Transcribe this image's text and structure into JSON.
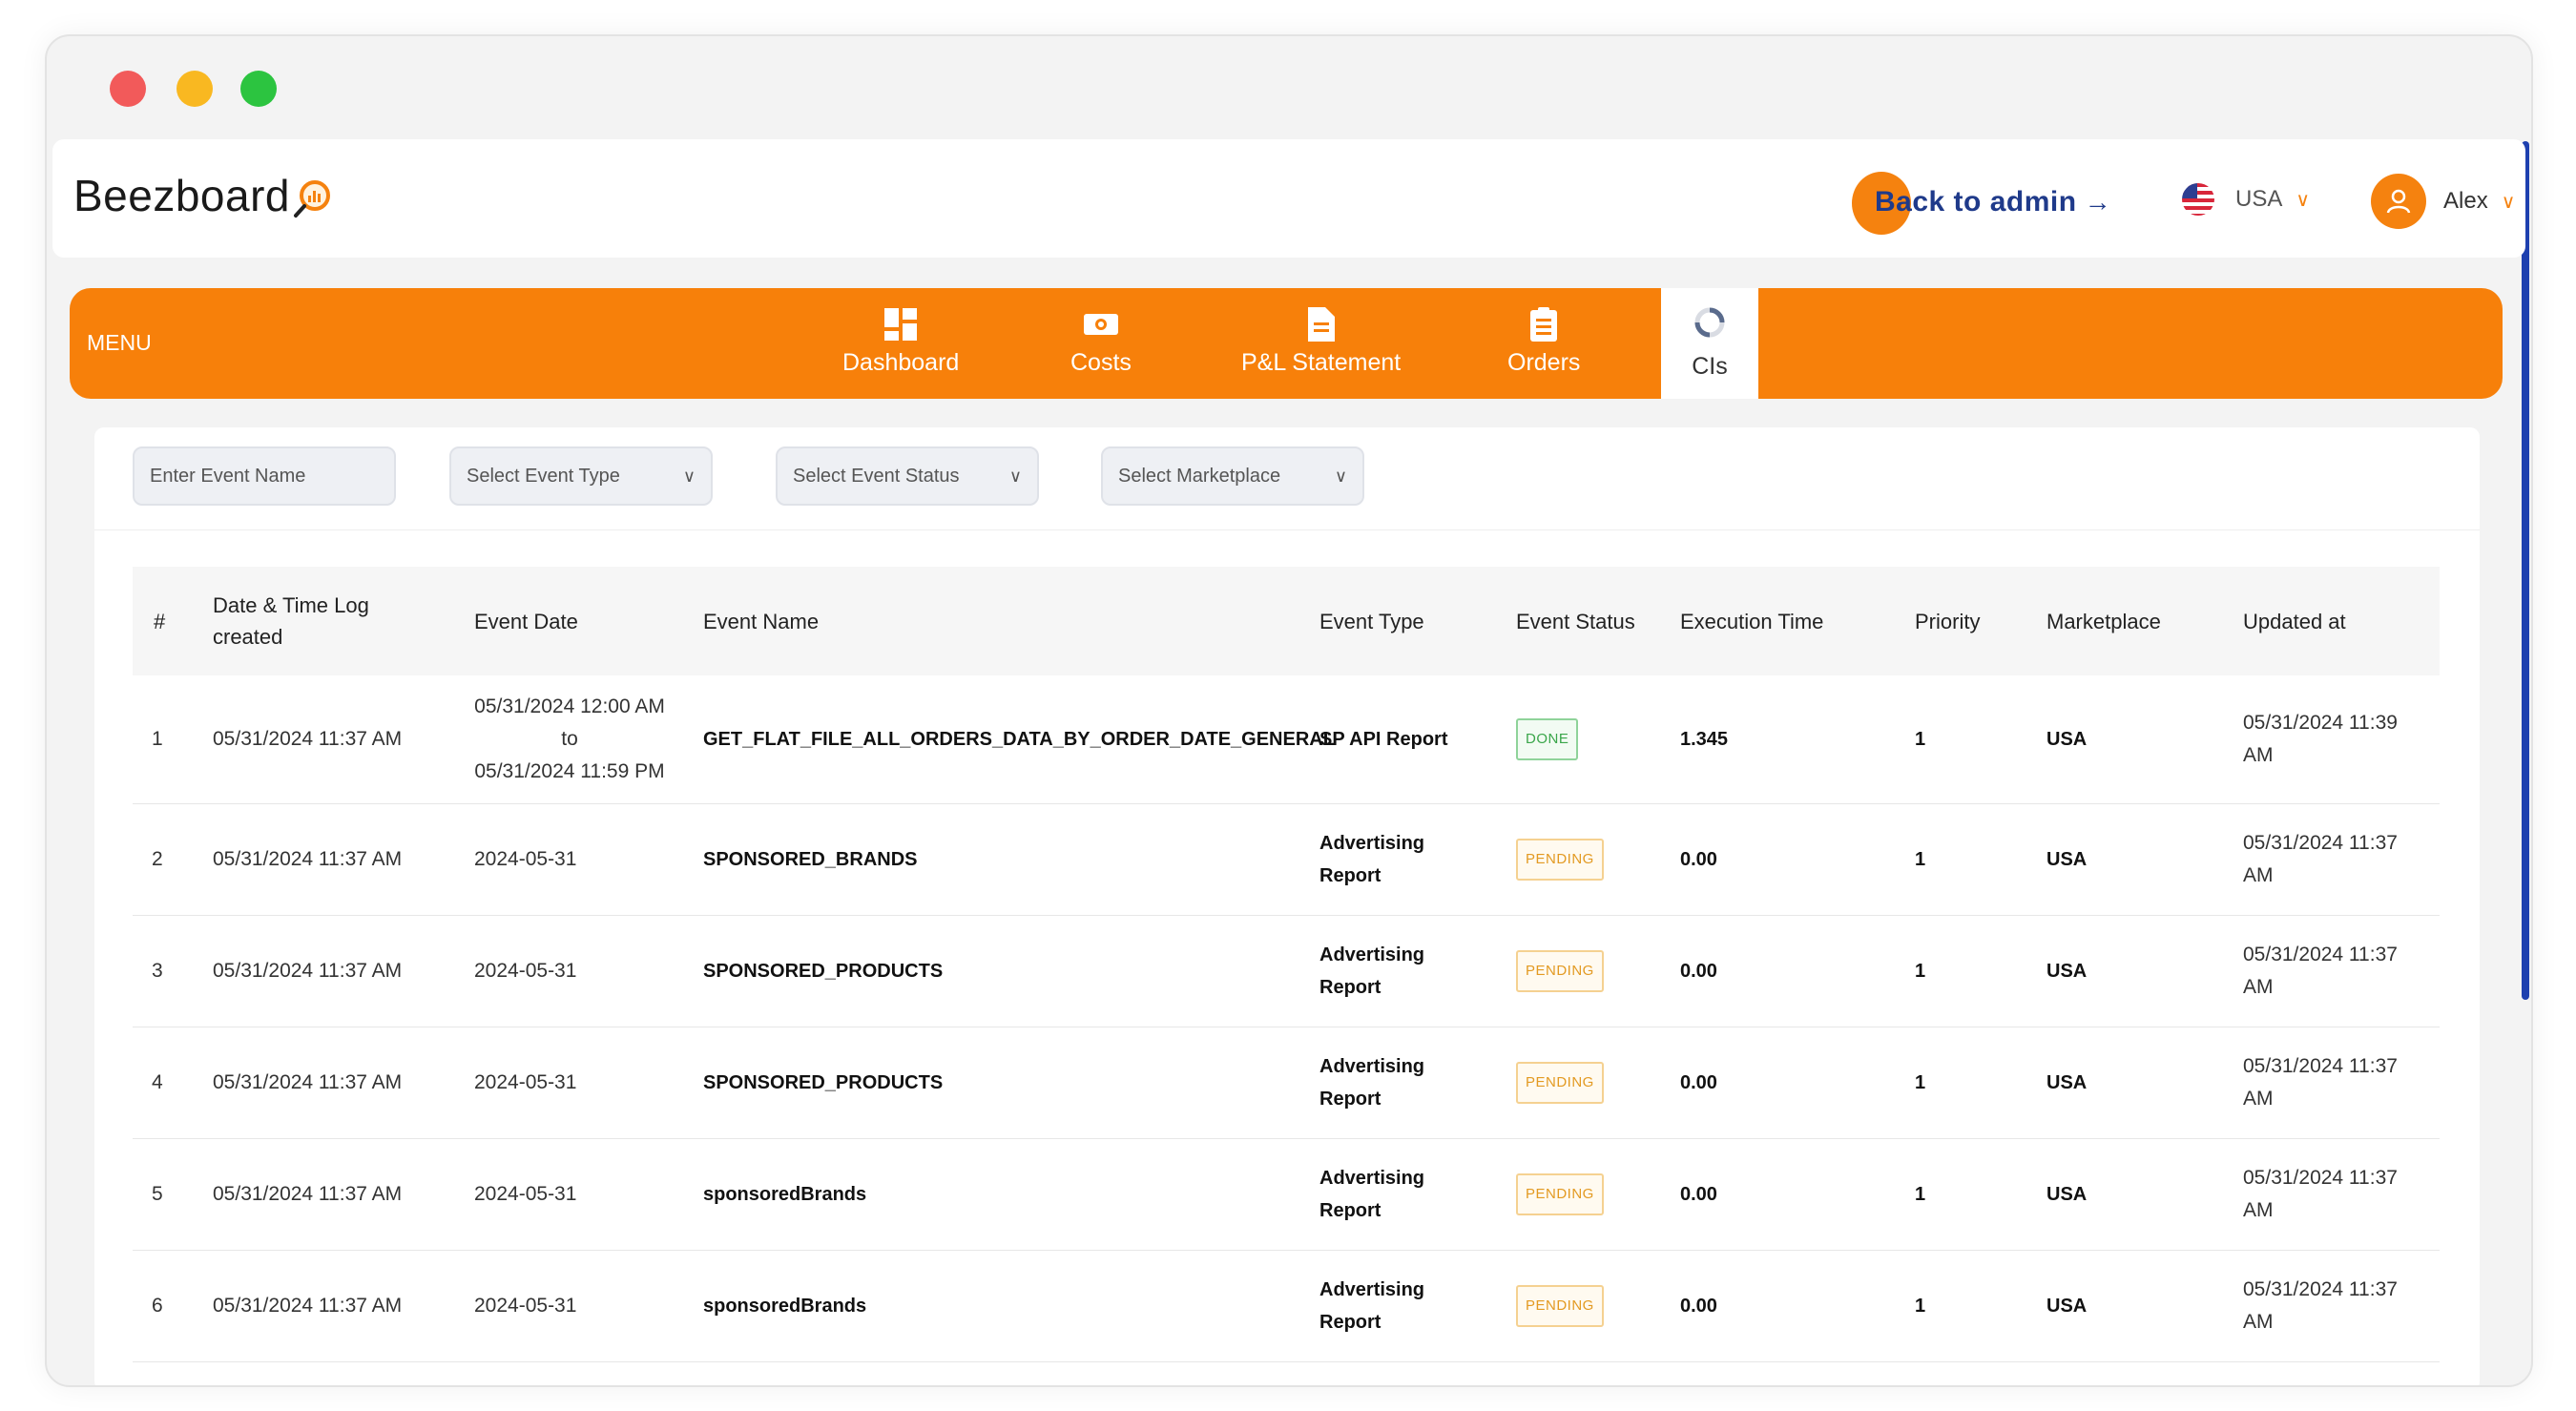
{
  "app": {
    "logo_text": "Beezboard",
    "back_to_admin": "Back to admin",
    "back_arrow": "→",
    "country": "USA",
    "user": "Alex"
  },
  "menu": {
    "label": "MENU",
    "items": [
      {
        "label": "Dashboard",
        "icon": "dashboard-icon"
      },
      {
        "label": "Costs",
        "icon": "money-icon"
      },
      {
        "label": "P&L Statement",
        "icon": "document-icon"
      },
      {
        "label": "Orders",
        "icon": "clipboard-icon"
      },
      {
        "label": "CIs",
        "icon": "spinner-icon",
        "active": true
      }
    ]
  },
  "filters": {
    "event_name_placeholder": "Enter Event Name",
    "event_type": "Select Event Type",
    "event_status": "Select Event Status",
    "marketplace": "Select Marketplace"
  },
  "table": {
    "headers": [
      "#",
      "Date & Time Log created",
      "Event Date",
      "Event Name",
      "Event Type",
      "Event Status",
      "Execution Time",
      "Priority",
      "Marketplace",
      "Updated at"
    ],
    "rows": [
      {
        "num": "1",
        "created": "05/31/2024 11:37 AM",
        "event_date_start": "05/31/2024 12:00 AM",
        "event_date_to": "to",
        "event_date_end": "05/31/2024 11:59 PM",
        "name": "GET_FLAT_FILE_ALL_ORDERS_DATA_BY_ORDER_DATE_GENERAL",
        "type": "SP API Report",
        "status": "DONE",
        "exec": "1.345",
        "priority": "1",
        "marketplace": "USA",
        "updated": "05/31/2024 11:39 AM"
      },
      {
        "num": "2",
        "created": "05/31/2024 11:37 AM",
        "event_date": "2024-05-31",
        "name": "SPONSORED_BRANDS",
        "type_line1": "Advertising",
        "type_line2": "Report",
        "status": "PENDING",
        "exec": "0.00",
        "priority": "1",
        "marketplace": "USA",
        "updated": "05/31/2024 11:37 AM"
      },
      {
        "num": "3",
        "created": "05/31/2024 11:37 AM",
        "event_date": "2024-05-31",
        "name": "SPONSORED_PRODUCTS",
        "type_line1": "Advertising",
        "type_line2": "Report",
        "status": "PENDING",
        "exec": "0.00",
        "priority": "1",
        "marketplace": "USA",
        "updated": "05/31/2024 11:37 AM"
      },
      {
        "num": "4",
        "created": "05/31/2024 11:37 AM",
        "event_date": "2024-05-31",
        "name": "SPONSORED_PRODUCTS",
        "type_line1": "Advertising",
        "type_line2": "Report",
        "status": "PENDING",
        "exec": "0.00",
        "priority": "1",
        "marketplace": "USA",
        "updated": "05/31/2024 11:37 AM"
      },
      {
        "num": "5",
        "created": "05/31/2024 11:37 AM",
        "event_date": "2024-05-31",
        "name": "sponsoredBrands",
        "type_line1": "Advertising",
        "type_line2": "Report",
        "status": "PENDING",
        "exec": "0.00",
        "priority": "1",
        "marketplace": "USA",
        "updated": "05/31/2024 11:37 AM"
      },
      {
        "num": "6",
        "created": "05/31/2024 11:37 AM",
        "event_date": "2024-05-31",
        "name": "sponsoredBrands",
        "type_line1": "Advertising",
        "type_line2": "Report",
        "status": "PENDING",
        "exec": "0.00",
        "priority": "1",
        "marketplace": "USA",
        "updated": "05/31/2024 11:37 AM"
      }
    ]
  },
  "colors": {
    "brand_orange": "#f7800a",
    "admin_blue": "#1f3a8a",
    "done_green": "#3aa64a",
    "pending_amber": "#e39a22"
  }
}
